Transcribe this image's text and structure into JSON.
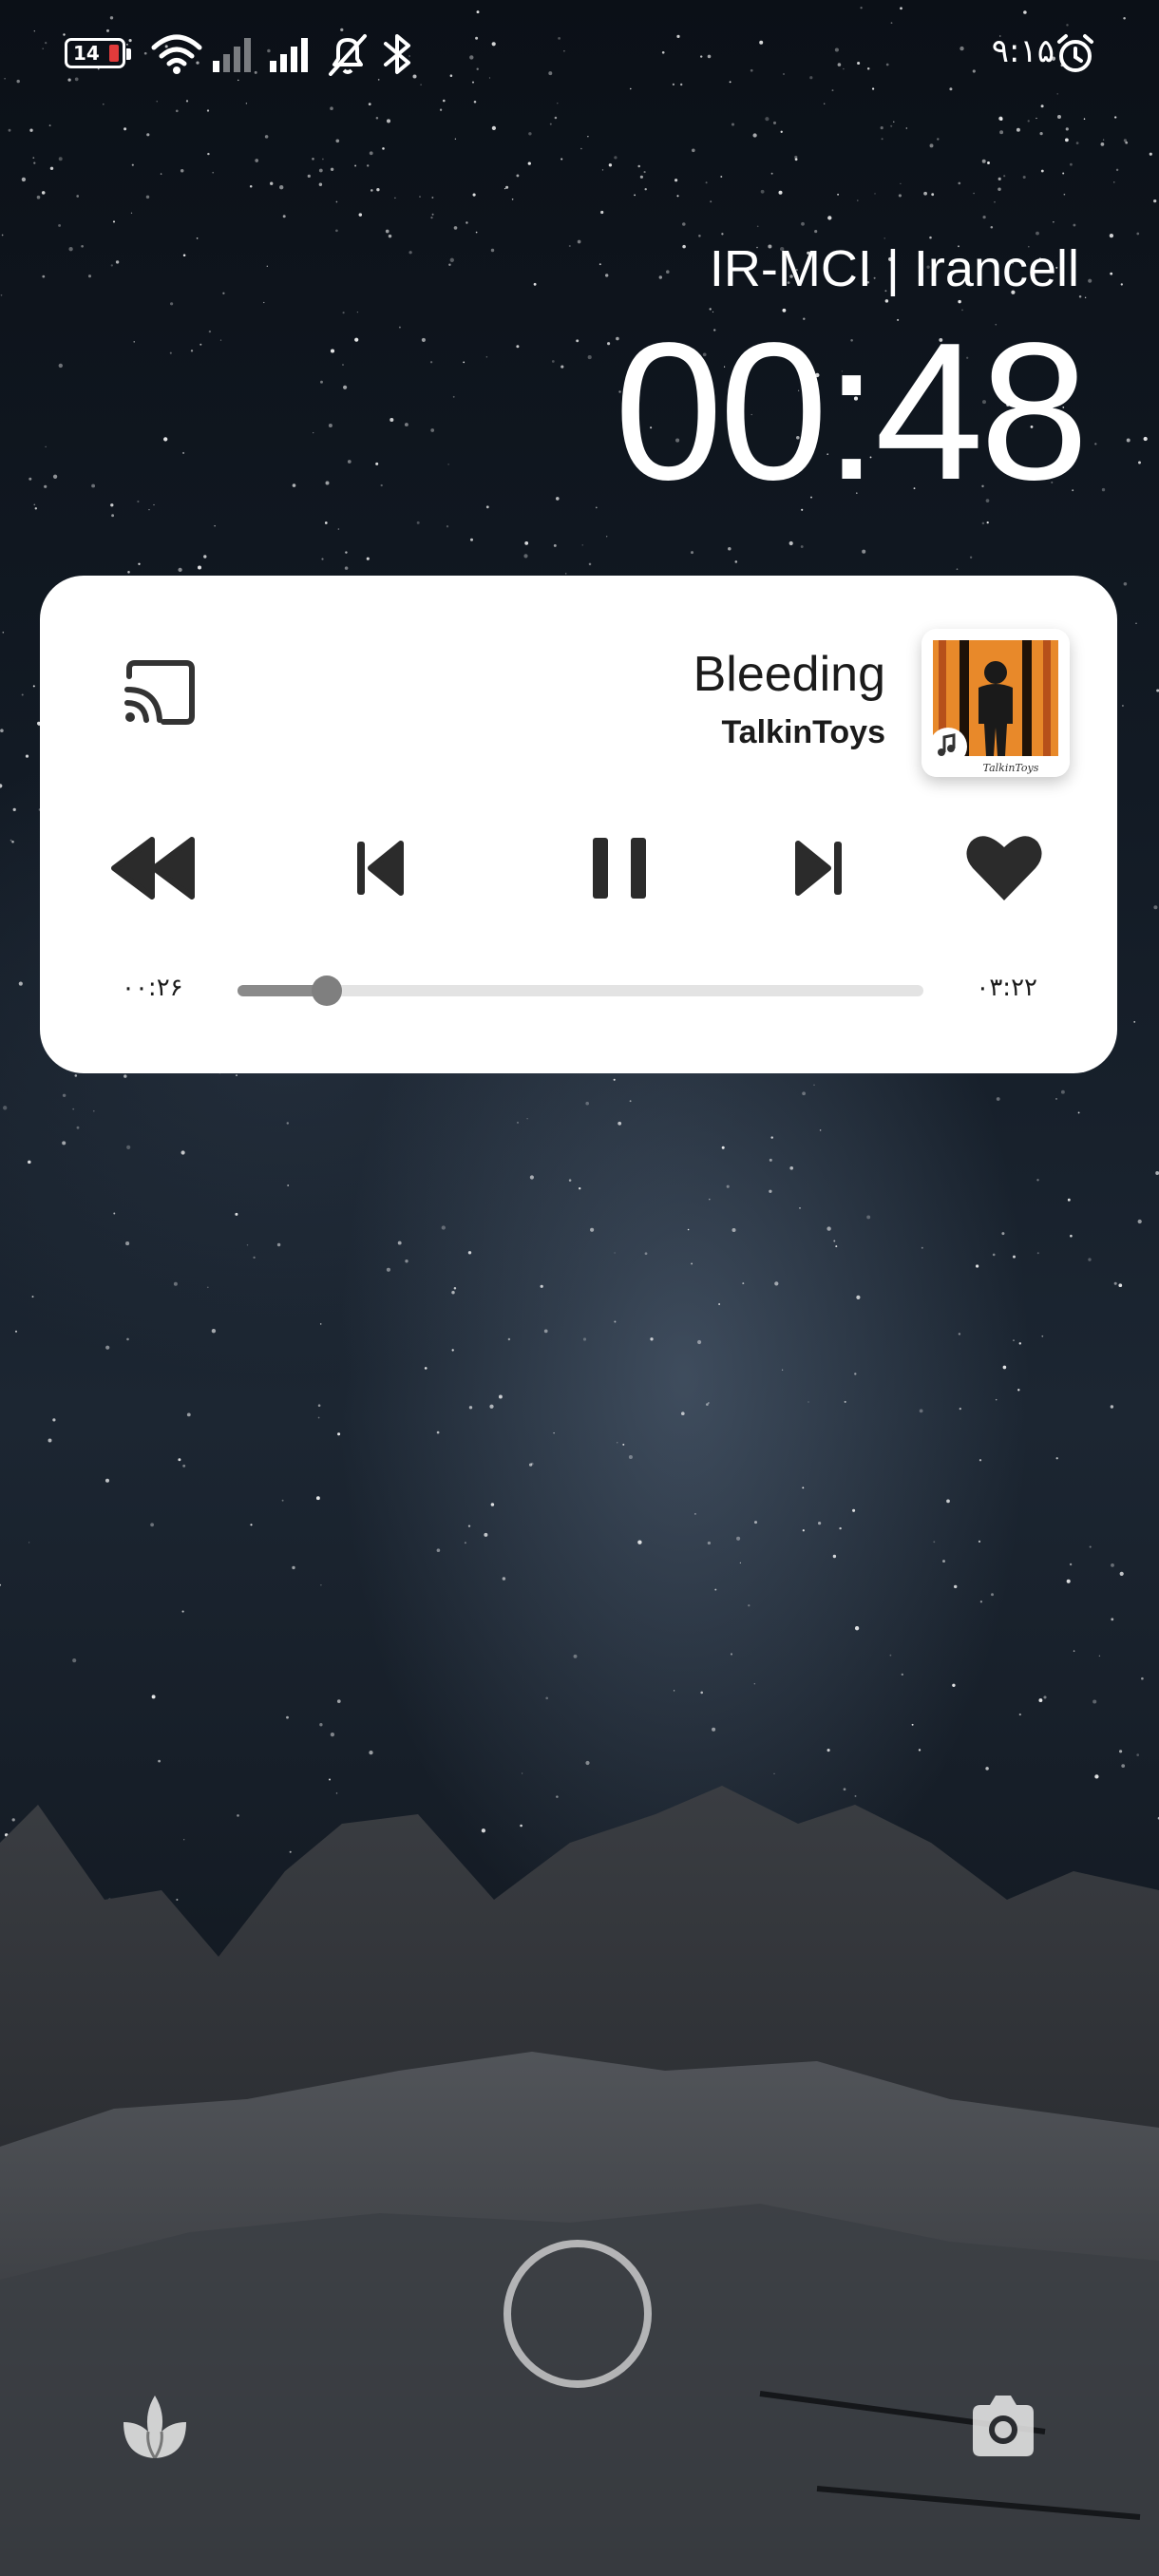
{
  "status_bar": {
    "battery_level": "14",
    "battery_fraction": 0.14,
    "time": "۹:۱۵",
    "icons": [
      "wifi-icon",
      "signal-weak-icon",
      "signal-full-icon",
      "bell-muted-icon",
      "bluetooth-icon",
      "alarm-icon"
    ]
  },
  "lockscreen": {
    "carrier": "IR-MCI | Irancell",
    "clock": "00:48"
  },
  "media": {
    "title": "Bleeding",
    "artist": "TalkinToys",
    "album_art_caption": "TalkinToys",
    "elapsed": "۰۰:۲۶",
    "total": "۰۳:۲۲",
    "progress": 0.13,
    "controls": [
      "rewind-icon",
      "skip-previous-icon",
      "pause-icon",
      "skip-next-icon",
      "heart-icon"
    ],
    "cast_icon": "cast-icon"
  },
  "bottom": {
    "left_icon": "flower-icon",
    "right_icon": "camera-icon"
  },
  "colors": {
    "card_bg": "#ffffff",
    "battery_low": "#e23b3b",
    "album_orange": "#e8892a"
  }
}
